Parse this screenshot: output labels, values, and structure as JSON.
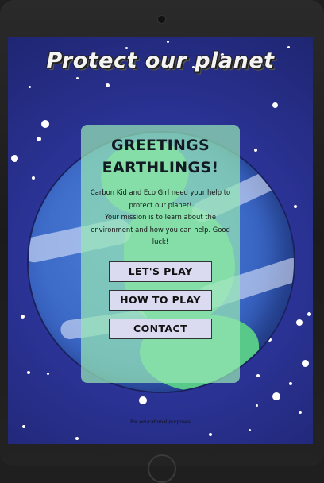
{
  "app": {
    "title": "Protect our planet"
  },
  "intro_card": {
    "heading": "GREETINGS EARTHLINGS!",
    "lines": [
      "Carbon Kid and Eco Girl need your help to protect our planet!",
      "Your mission is to learn about the environment and how you can help. Good luck!"
    ]
  },
  "menu": {
    "play_label": "LET'S PLAY",
    "how_to_label": "HOW TO PLAY",
    "contact_label": "CONTACT"
  },
  "footer": {
    "text": "For educational purposes"
  },
  "colors": {
    "background": "#2c3499",
    "planet_ocean": "#3a66c4",
    "planet_land": "#59c98a",
    "card": "#96e6b4",
    "button": "#dadaf1"
  }
}
